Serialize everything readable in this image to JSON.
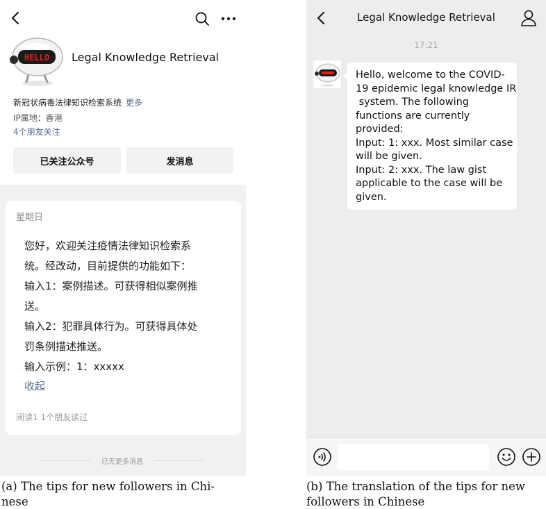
{
  "panel_a": {
    "account_name": "Legal Knowledge Retrieval",
    "description": "新冠状病毒法律知识检索系统",
    "more_link": "更多",
    "ip_location": "IP属地：香港",
    "friends_following": "4个朋友关注",
    "follow_button": "已关注公众号",
    "message_button": "发消息",
    "message_day": "星期日",
    "message_lines": [
      "您好，欢迎关注疫情法律知识检索系",
      "统。经改动，目前提供的功能如下：",
      "输入1：案例描述。可获得相似案例推",
      "送。",
      "输入2：犯罪具体行为。可获得具体处",
      "罚条例描述推送。",
      "输入示例：1：xxxxx"
    ],
    "collapse_link": "收起",
    "read_stats": "阅读1  1个朋友读过",
    "end_of_messages": "已无更多消息",
    "avatar_screen_text": "HELLO",
    "icons": [
      "back-arrow-icon",
      "search-icon",
      "more-dots-icon"
    ]
  },
  "panel_b": {
    "title": "Legal Knowledge Retrieval",
    "time": "17:21",
    "bubble_lines": [
      "Hello, welcome to the COVID-",
      "19 epidemic legal knowledge IR",
      " system. The following",
      "functions are currently",
      "provided:",
      "Input: 1: xxx. Most similar case",
      "will be given.",
      "Input: 2: xxx. The law gist",
      "applicable to the case will be",
      "given."
    ],
    "icons": [
      "back-arrow-icon",
      "user-icon",
      "voice-icon",
      "emoji-icon",
      "plus-icon"
    ]
  },
  "captions": {
    "a_line1": "(a) The tips for new followers in Chi-",
    "a_line2": "nese",
    "b_line1": "(b) The translation of the tips for new",
    "b_line2": "followers in Chinese"
  },
  "colors": {
    "link_blue": "#576b95",
    "chat_background": "#ededed",
    "feed_background": "#f1f1f1",
    "avatar_screen_red": "#d4271b"
  }
}
